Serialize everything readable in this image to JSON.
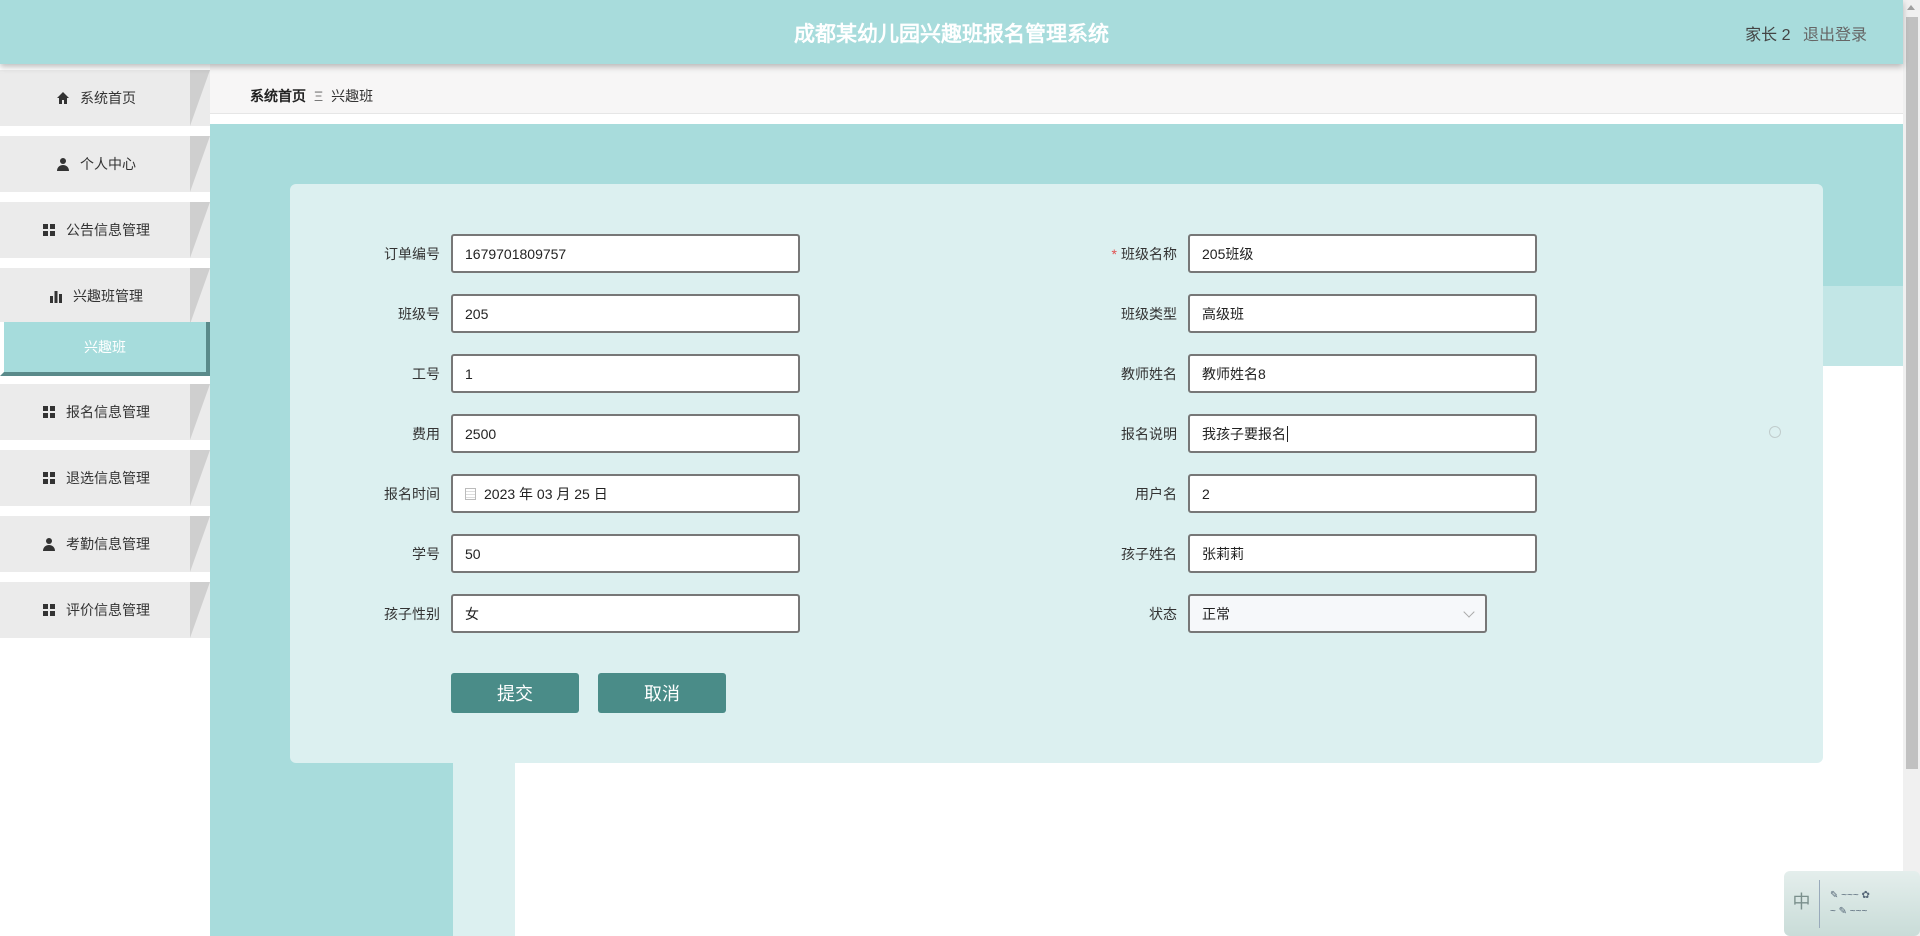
{
  "header": {
    "title": "成都某幼儿园兴趣班报名管理系统",
    "user": "家长 2",
    "logout": "退出登录"
  },
  "sidebar": {
    "items": [
      {
        "label": "系统首页",
        "icon": "home-icon"
      },
      {
        "label": "个人中心",
        "icon": "user-icon"
      },
      {
        "label": "公告信息管理",
        "icon": "grid-icon"
      },
      {
        "label": "兴趣班管理",
        "icon": "bar-chart-icon"
      },
      {
        "label": "兴趣班",
        "active": true
      },
      {
        "label": "报名信息管理",
        "icon": "grid-icon"
      },
      {
        "label": "退选信息管理",
        "icon": "grid-icon"
      },
      {
        "label": "考勤信息管理",
        "icon": "user-icon"
      },
      {
        "label": "评价信息管理",
        "icon": "grid-icon"
      }
    ]
  },
  "breadcrumb": {
    "home": "系统首页",
    "separator": "Ξ",
    "current": "兴趣班"
  },
  "form": {
    "left": [
      {
        "label": "订单编号",
        "value": "1679701809757"
      },
      {
        "label": "班级号",
        "value": "205"
      },
      {
        "label": "工号",
        "value": "1"
      },
      {
        "label": "费用",
        "value": "2500"
      },
      {
        "label": "报名时间",
        "value": "2023 年 03 月 25 日"
      },
      {
        "label": "学号",
        "value": "50"
      },
      {
        "label": "孩子性别",
        "value": "女"
      }
    ],
    "right": [
      {
        "label": "班级名称",
        "value": "205班级",
        "required": "*"
      },
      {
        "label": "班级类型",
        "value": "高级班"
      },
      {
        "label": "教师姓名",
        "value": "教师姓名8"
      },
      {
        "label": "报名说明",
        "value": "我孩子要报名"
      },
      {
        "label": "用户名",
        "value": "2"
      },
      {
        "label": "孩子姓名",
        "value": "张莉莉"
      },
      {
        "label": "状态",
        "value": "正常"
      }
    ],
    "submit": "提交",
    "cancel": "取消"
  },
  "ime": {
    "mode": "中"
  },
  "colors": {
    "header": "#a8dcdc",
    "card": "#dcf0f0",
    "button": "#4a8c88"
  }
}
